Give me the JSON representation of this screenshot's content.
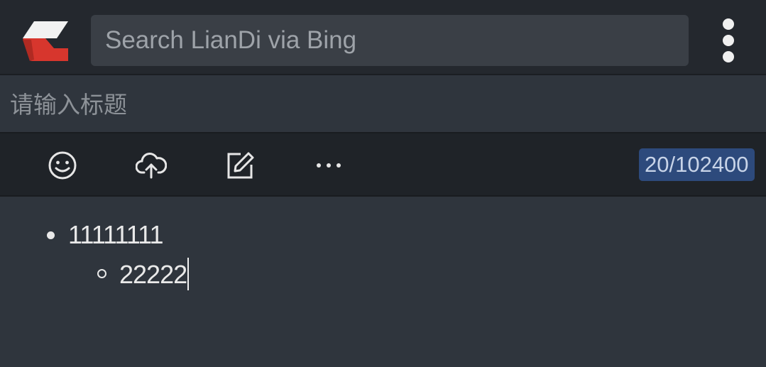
{
  "app": {
    "logo_icon": "liandi-logo-icon"
  },
  "search": {
    "placeholder": "Search LianDi via Bing",
    "value": ""
  },
  "title": {
    "placeholder": "请输入标题",
    "value": ""
  },
  "toolbar": {
    "buttons": [
      {
        "icon": "emoji-smile-icon"
      },
      {
        "icon": "cloud-upload-icon"
      },
      {
        "icon": "edit-icon"
      },
      {
        "icon": "more-horizontal-icon"
      }
    ],
    "counter": "20/102400"
  },
  "editor": {
    "items": [
      {
        "text": "11111111",
        "children": [
          {
            "text": "22222"
          }
        ]
      }
    ]
  },
  "colors": {
    "topbar": "#24282e",
    "background": "#2f353d",
    "toolbar": "#1f2328",
    "counter_bg": "#2d4a7c",
    "logo_red": "#d7362d",
    "logo_white": "#f2f2f2"
  }
}
